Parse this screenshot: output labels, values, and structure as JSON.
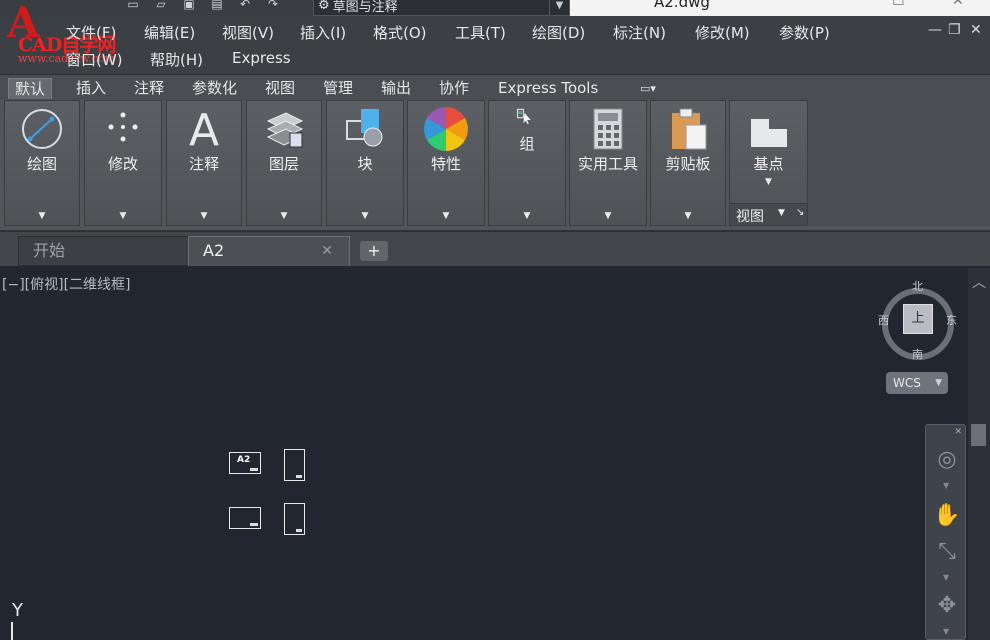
{
  "app": {
    "logo_letter": "A",
    "logo_text": "CAD自学网",
    "logo_url": "www.cadzxw.com",
    "workspace": "草图与注释",
    "doc_title": "A2.dwg"
  },
  "menu": [
    {
      "label": "文件(F)"
    },
    {
      "label": "编辑(E)"
    },
    {
      "label": "视图(V)"
    },
    {
      "label": "插入(I)"
    },
    {
      "label": "格式(O)"
    },
    {
      "label": "工具(T)"
    },
    {
      "label": "绘图(D)"
    },
    {
      "label": "标注(N)"
    },
    {
      "label": "修改(M)"
    },
    {
      "label": "参数(P)"
    },
    {
      "label": "窗口(W)"
    },
    {
      "label": "帮助(H)"
    },
    {
      "label": "Express"
    }
  ],
  "ribbon_tabs": [
    {
      "label": "默认"
    },
    {
      "label": "插入"
    },
    {
      "label": "注释"
    },
    {
      "label": "参数化"
    },
    {
      "label": "视图"
    },
    {
      "label": "管理"
    },
    {
      "label": "输出"
    },
    {
      "label": "协作"
    },
    {
      "label": "Express Tools"
    }
  ],
  "panels": [
    {
      "label": "绘图",
      "icon": "draw-icon"
    },
    {
      "label": "修改",
      "icon": "modify-icon"
    },
    {
      "label": "注释",
      "icon": "annotation-icon"
    },
    {
      "label": "图层",
      "icon": "layers-icon"
    },
    {
      "label": "块",
      "icon": "block-icon"
    },
    {
      "label": "特性",
      "icon": "properties-icon"
    },
    {
      "label": "组",
      "icon": "group-icon"
    },
    {
      "label": "实用工具",
      "icon": "utilities-icon"
    },
    {
      "label": "剪贴板",
      "icon": "clipboard-icon"
    },
    {
      "label": "基点",
      "icon": "base-point-icon"
    }
  ],
  "view_panel_label": "视图",
  "file_tabs": {
    "start": "开始",
    "current": "A2"
  },
  "viewport": {
    "label": "[−][俯视][二维线框]",
    "viewcube": {
      "top": "上",
      "north": "北",
      "south": "南",
      "east": "东",
      "west": "西"
    },
    "wcs": "WCS",
    "ucs_y": "Y",
    "thumb_label": "A2"
  }
}
